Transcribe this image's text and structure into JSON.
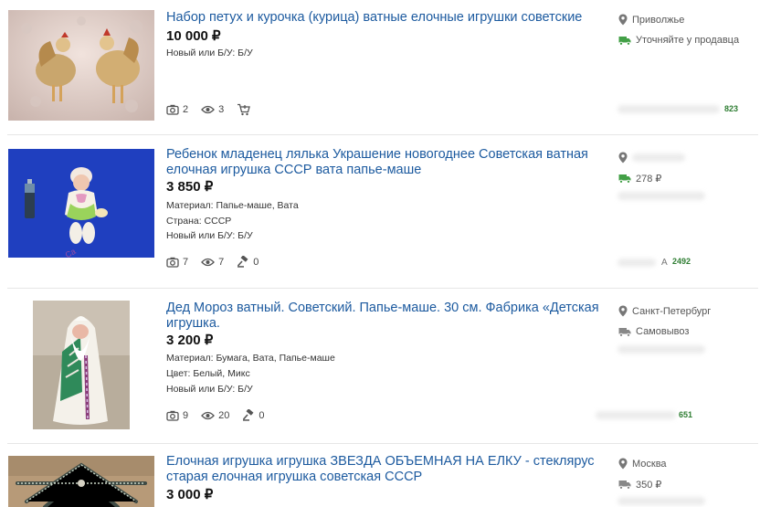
{
  "listings": [
    {
      "title": "Набор петух и курочка (курица) ватные елочные игрушки советские",
      "price": "10 000 ₽",
      "attrs": [
        "Новый или Б/У: Б/У"
      ],
      "stats": {
        "photos": "2",
        "views": "3"
      },
      "stat_third_icon": "cart-icon",
      "location": "Приволжье",
      "delivery": "Уточняйте у продавца",
      "seller_rating": "823"
    },
    {
      "title": "Ребенок младенец лялька Украшение новогоднее Советская ватная елочная игрушка СССР вата папье-маше",
      "price": "3 850 ₽",
      "attrs": [
        "Материал: Папье-маше, Вата",
        "Страна: СССР",
        "Новый или Б/У: Б/У"
      ],
      "stats": {
        "photos": "7",
        "views": "7",
        "bids": "0"
      },
      "stat_third_icon": "gavel-icon",
      "location": "",
      "delivery": "278 ₽",
      "seller_rating": "2492",
      "seller_name_partial": "А"
    },
    {
      "title": "Дед Мороз ватный. Советский. Папье-маше. 30 см. Фабрика «Детская игрушка.",
      "price": "3 200 ₽",
      "attrs": [
        "Материал: Бумага, Вата, Папье-маше",
        "Цвет: Белый, Микс",
        "Новый или Б/У: Б/У"
      ],
      "stats": {
        "photos": "9",
        "views": "20",
        "bids": "0"
      },
      "stat_third_icon": "gavel-icon",
      "location": "Санкт-Петербург",
      "delivery": "Самовывоз",
      "seller_rating": "651"
    },
    {
      "title": "Елочная игрушка игрушка ЗВЕЗДА ОБЪЕМНАЯ НА ЕЛКУ - стеклярус старая елочная игрушка советская СССР",
      "price": "3 000 ₽",
      "location": "Москва",
      "delivery": "350 ₽"
    }
  ],
  "colors": {
    "title_link": "#1c5a9f",
    "delivery_icon": "#43a047",
    "rating": "#2e7d32"
  }
}
